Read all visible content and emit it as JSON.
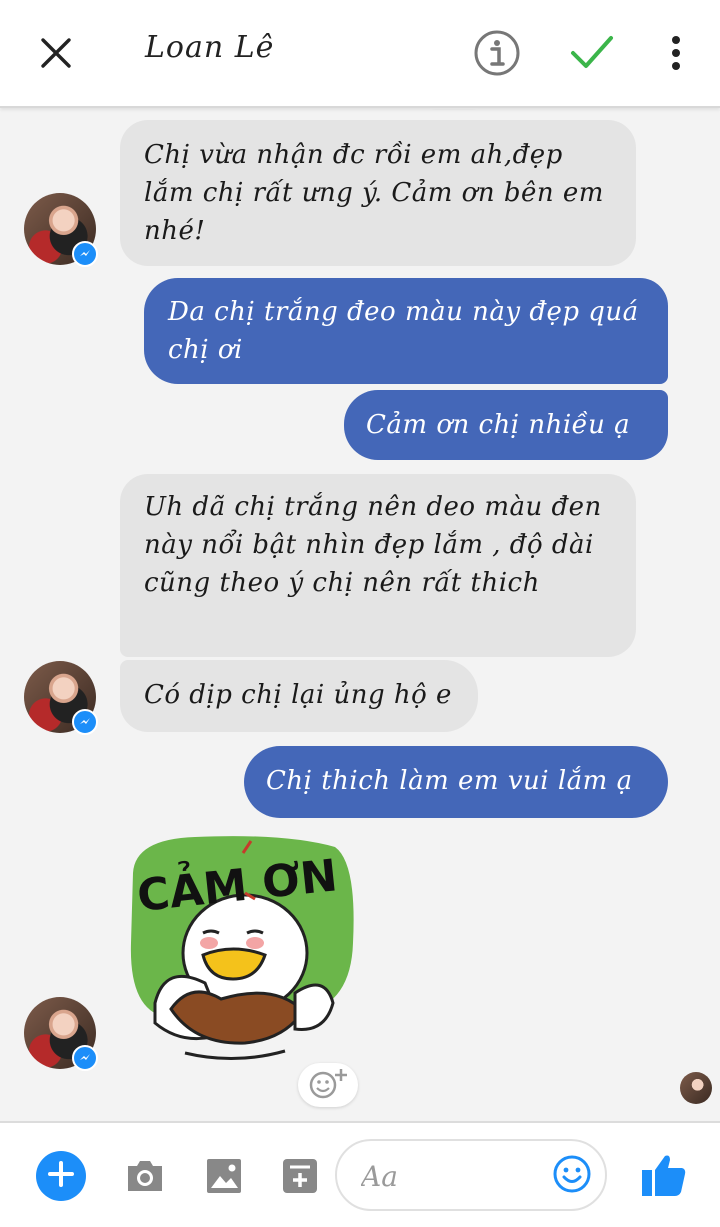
{
  "header": {
    "title": "Loan Lê"
  },
  "messages": [
    {
      "text": "Chị vừa nhận đc rồi em ah,đẹp lắm chị rất ưng ý. Cảm ơn bên em nhé!"
    },
    {
      "text": "Da chị trắng đeo màu này đẹp quá chị ơi"
    },
    {
      "text": "Cảm ơn chị nhiều ạ"
    },
    {
      "text": "Uh dã chị trắng nên deo màu đen này nổi bật nhìn đẹp lắm , độ dài cũng theo ý chị nên rất thich"
    },
    {
      "text": "Có dịp chị lại ủng hộ e"
    },
    {
      "text": "Chị thich làm em vui lắm ạ"
    }
  ],
  "sticker": {
    "text": "CẢM ƠN"
  },
  "composer": {
    "placeholder": "Aa"
  },
  "colors": {
    "outgoing": "#4467b8",
    "incoming": "#e4e4e4",
    "accent": "#1c8ef9",
    "check": "#3bb54a"
  },
  "icons": [
    "close-icon",
    "info-icon",
    "check-icon",
    "more-icon",
    "add-icon",
    "camera-icon",
    "gallery-icon",
    "sticker-icon",
    "emoji-icon",
    "like-icon",
    "messenger-badge-icon",
    "add-reaction-icon"
  ]
}
